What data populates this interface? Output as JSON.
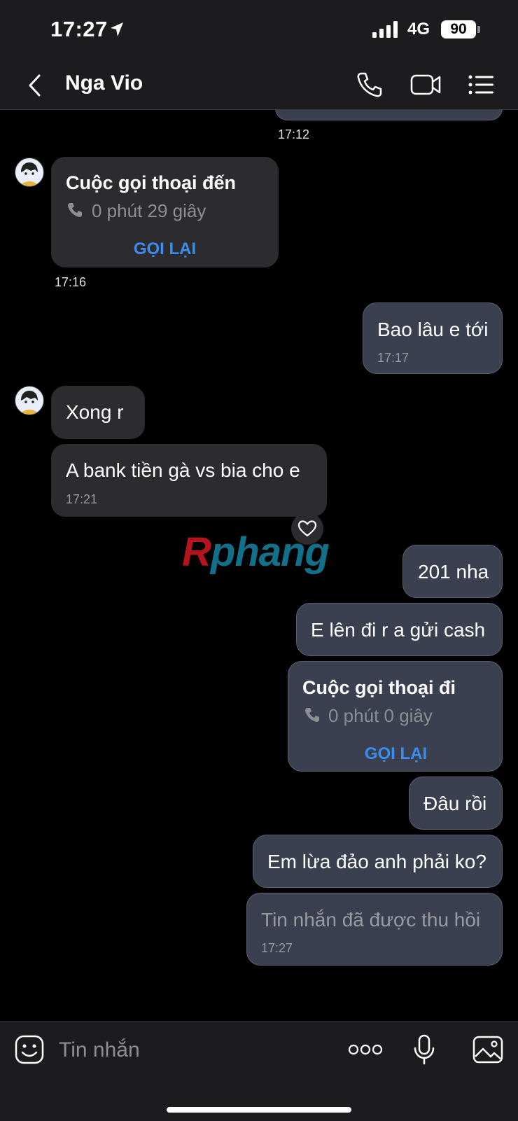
{
  "status_bar": {
    "time": "17:27",
    "network": "4G",
    "battery": "90"
  },
  "header": {
    "contact_name": "Nga Vio"
  },
  "messages": {
    "ts1": "17:12",
    "incoming_call": {
      "title": "Cuộc gọi thoại đến",
      "duration": "0 phút 29 giây",
      "action": "GỌI LẠI",
      "time": "17:16"
    },
    "m1": {
      "text": "Bao lâu e tới",
      "time": "17:17"
    },
    "m2": {
      "text": "Xong r"
    },
    "m3": {
      "text": "A bank tiền gà vs bia cho e",
      "time": "17:21"
    },
    "m4": {
      "text": "201 nha"
    },
    "m5": {
      "text": "E lên đi r a gửi cash"
    },
    "outgoing_call": {
      "title": "Cuộc gọi thoại đi",
      "duration": "0 phút 0 giây",
      "action": "GỌI LẠI"
    },
    "m6": {
      "text": "Đâu rồi"
    },
    "m7": {
      "text": "Em lừa đảo anh phải ko?"
    },
    "m8": {
      "text": "Tin nhắn đã được thu hồi",
      "time": "17:27"
    }
  },
  "watermark": {
    "r": "R",
    "rest": "phang"
  },
  "input": {
    "placeholder": "Tin nhắn"
  },
  "colors": {
    "accent": "#3d8cf0",
    "outgoing_bubble": "#3a4050",
    "incoming_bubble": "#2c2c2e"
  }
}
